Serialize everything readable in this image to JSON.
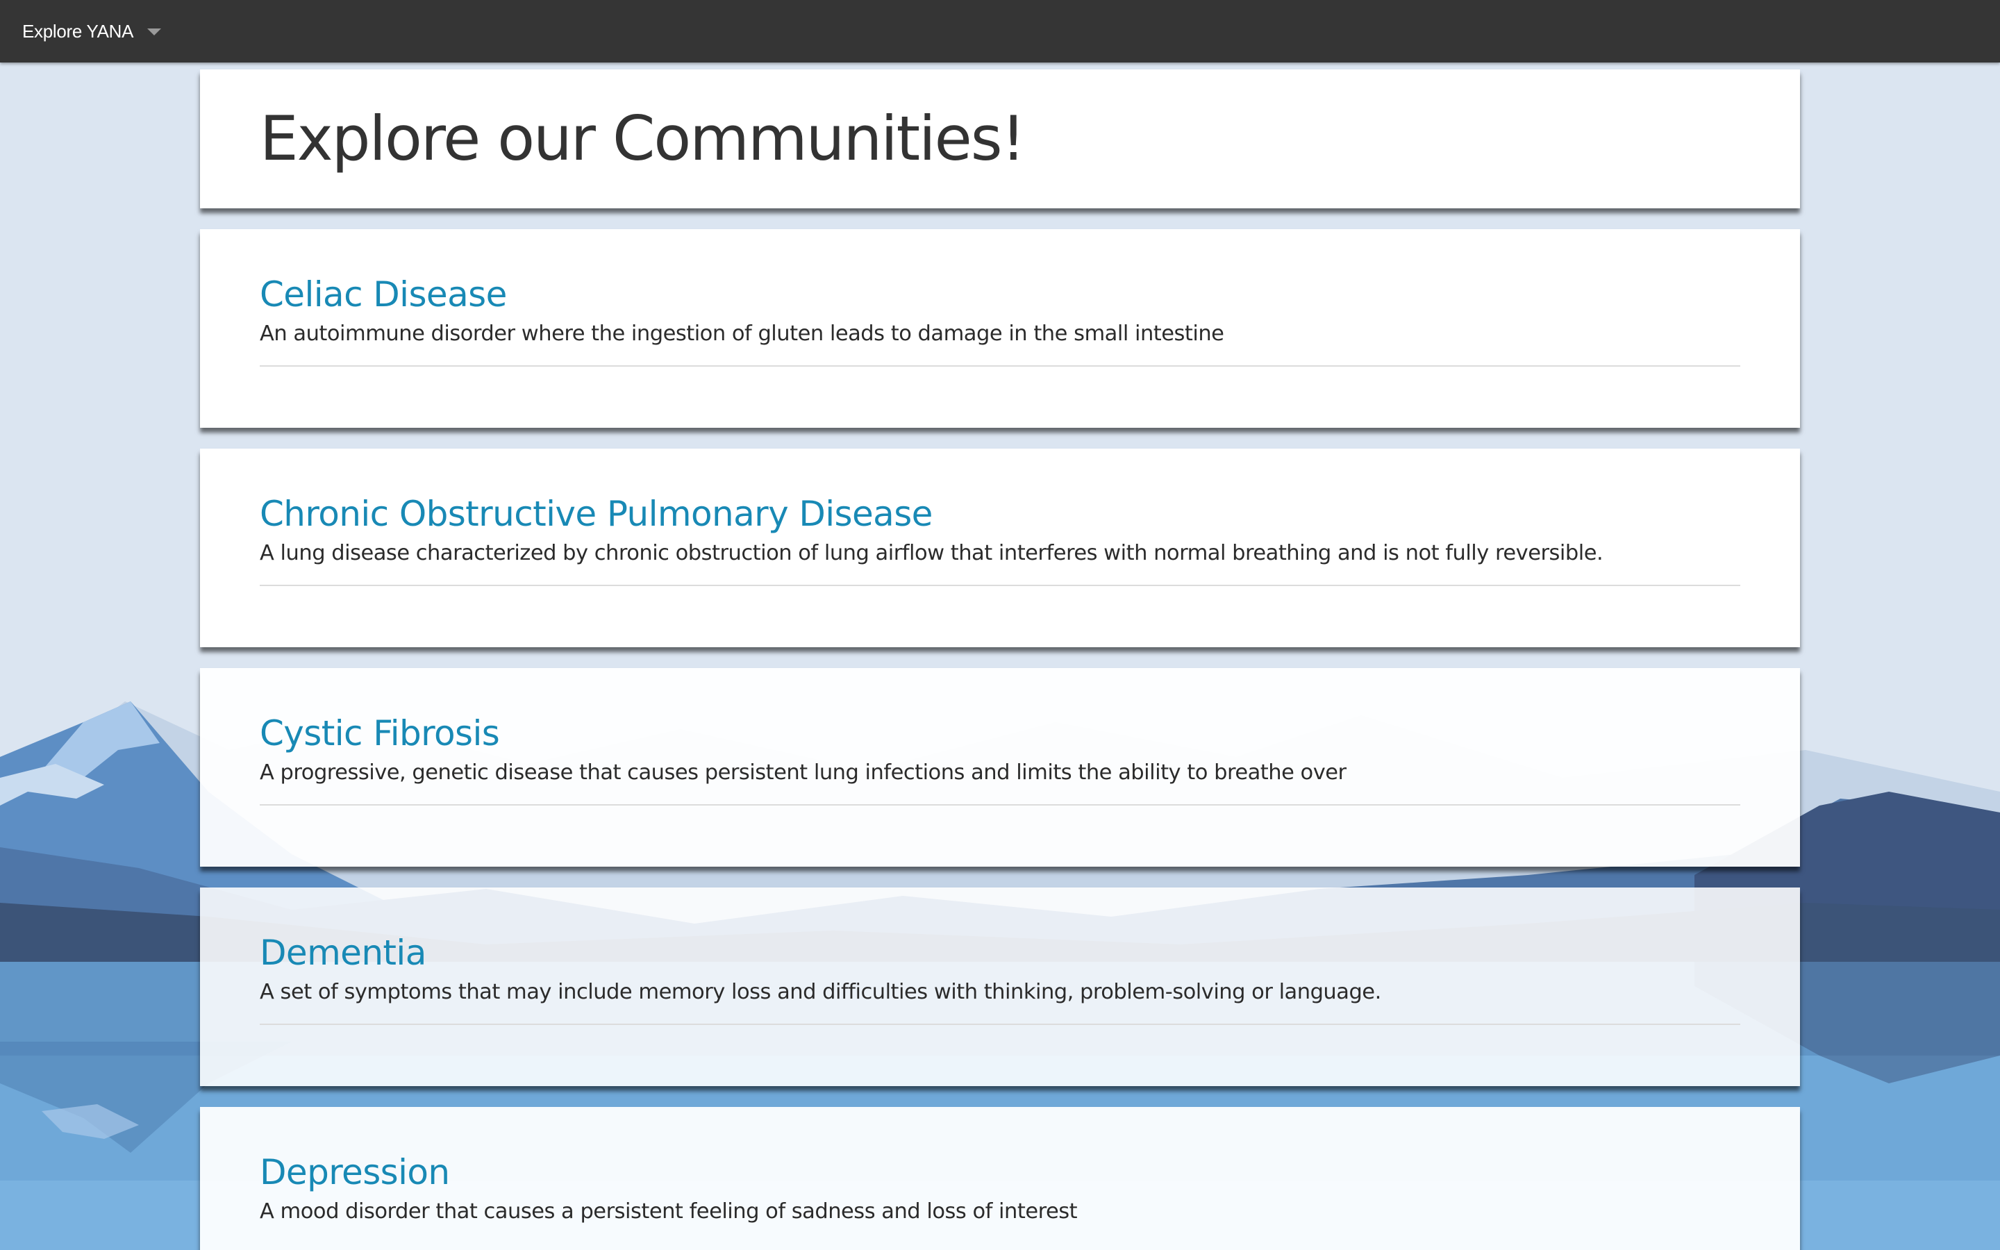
{
  "navbar": {
    "menu_label": "Explore YANA"
  },
  "page": {
    "title": "Explore our Communities!"
  },
  "communities": [
    {
      "name": "Celiac Disease",
      "description": "An autoimmune disorder where the ingestion of gluten leads to damage in the small intestine"
    },
    {
      "name": "Chronic Obstructive Pulmonary Disease",
      "description": "A lung disease characterized by chronic obstruction of lung airflow that interferes with normal breathing and is not fully reversible."
    },
    {
      "name": "Cystic Fibrosis",
      "description": "A progressive, genetic disease that causes persistent lung infections and limits the ability to breathe over"
    },
    {
      "name": "Dementia",
      "description": "A set of symptoms that may include memory loss and difficulties with thinking, problem-solving or language."
    },
    {
      "name": "Depression",
      "description": "A mood disorder that causes a persistent feeling of sadness and loss of interest"
    }
  ],
  "colors": {
    "navbar_bg": "#353535",
    "link": "#1889b5",
    "sky": "#dbe5f1",
    "lake": "#6fa8d8"
  }
}
